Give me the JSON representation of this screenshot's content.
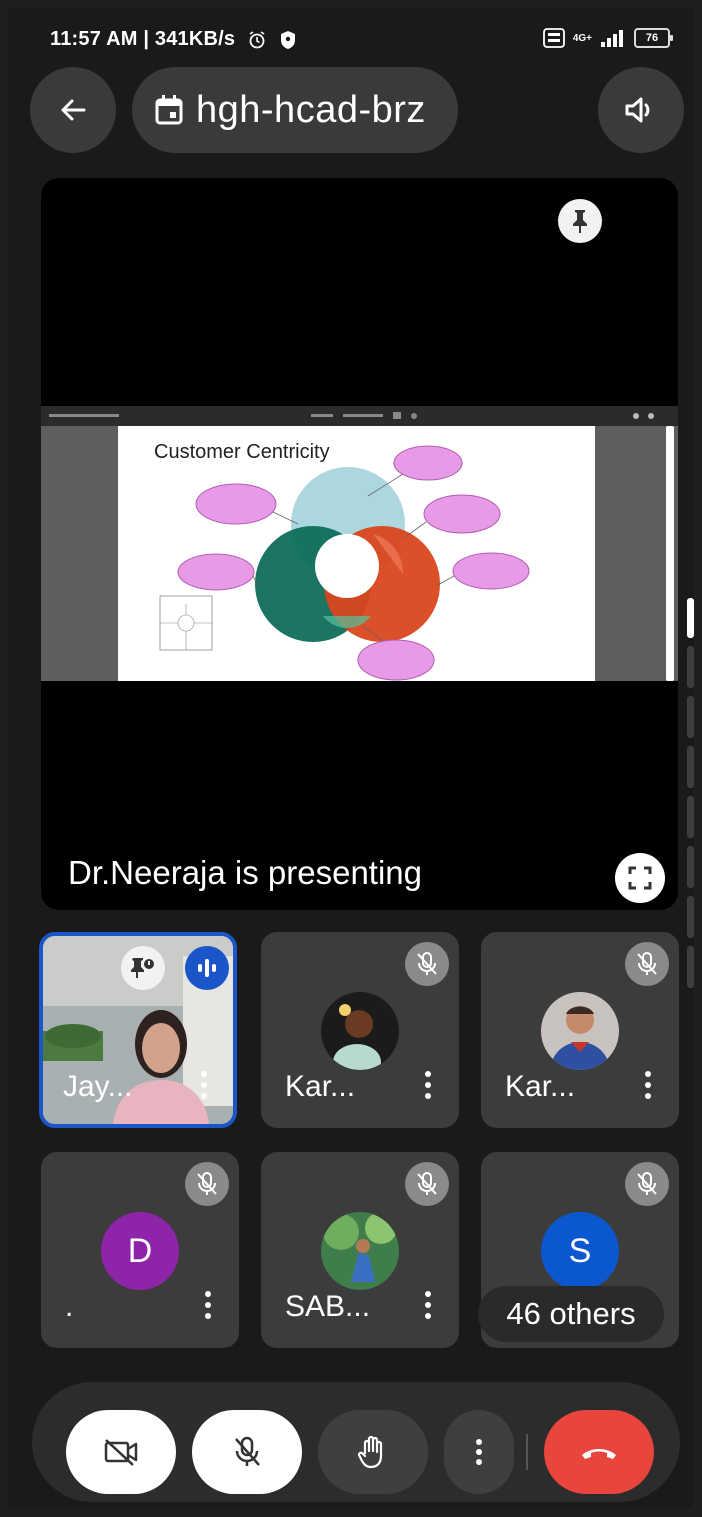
{
  "status_bar": {
    "time": "11:57 AM",
    "speed": "341KB/s",
    "network": "4G+",
    "battery": "76"
  },
  "top_bar": {
    "meeting_code": "hgh-hcad-brz"
  },
  "presentation": {
    "slide_title": "Customer Centricity",
    "presenter_text": "Dr.Neeraja is presenting"
  },
  "participants": [
    {
      "name": "Jay...",
      "muted": false,
      "speaking": true,
      "pinned": true
    },
    {
      "name": "Kar...",
      "muted": true
    },
    {
      "name": "Kar...",
      "muted": true
    },
    {
      "name": ".",
      "initial": "D",
      "muted": true,
      "avatar_color": "#8e24aa"
    },
    {
      "name": "SAB...",
      "muted": true
    },
    {
      "name": "",
      "initial": "S",
      "muted": true,
      "avatar_color": "#0b57d0"
    }
  ],
  "others": "46 others",
  "controls": {
    "camera": "camera-off",
    "mic": "mic-off",
    "hand": "raise-hand",
    "more": "more-options",
    "end": "end-call"
  },
  "colors": {
    "end_call": "#e8453c",
    "active_border": "#1a56c9",
    "speaking_badge": "#1a56c9"
  }
}
